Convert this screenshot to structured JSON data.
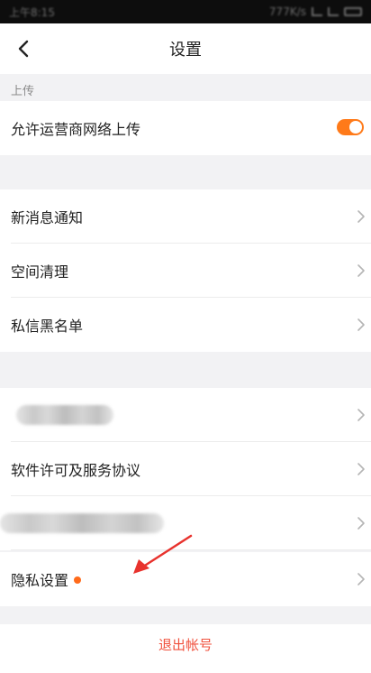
{
  "status_bar": {
    "time": "上午8:15",
    "network_speed": "777K/s"
  },
  "header": {
    "title": "设置",
    "back_icon": "chevron-left-icon"
  },
  "sections": {
    "upload": {
      "header": "上传",
      "items": [
        {
          "label": "允许运营商网络上传",
          "toggle": true
        }
      ]
    },
    "group2": {
      "items": [
        {
          "label": "新消息通知"
        },
        {
          "label": "空间清理"
        },
        {
          "label": "私信黑名单"
        }
      ]
    },
    "group3": {
      "items": [
        {
          "label": ""
        },
        {
          "label": "软件许可及服务协议"
        },
        {
          "label": ""
        },
        {
          "label": "隐私设置",
          "badge": "red-dot"
        }
      ]
    }
  },
  "footer": {
    "logout_label": "退出帐号"
  },
  "colors": {
    "accent": "#ff7a19",
    "logout": "#f0503c",
    "background": "#f2f2f4",
    "annotation_arrow": "#e8322d"
  }
}
